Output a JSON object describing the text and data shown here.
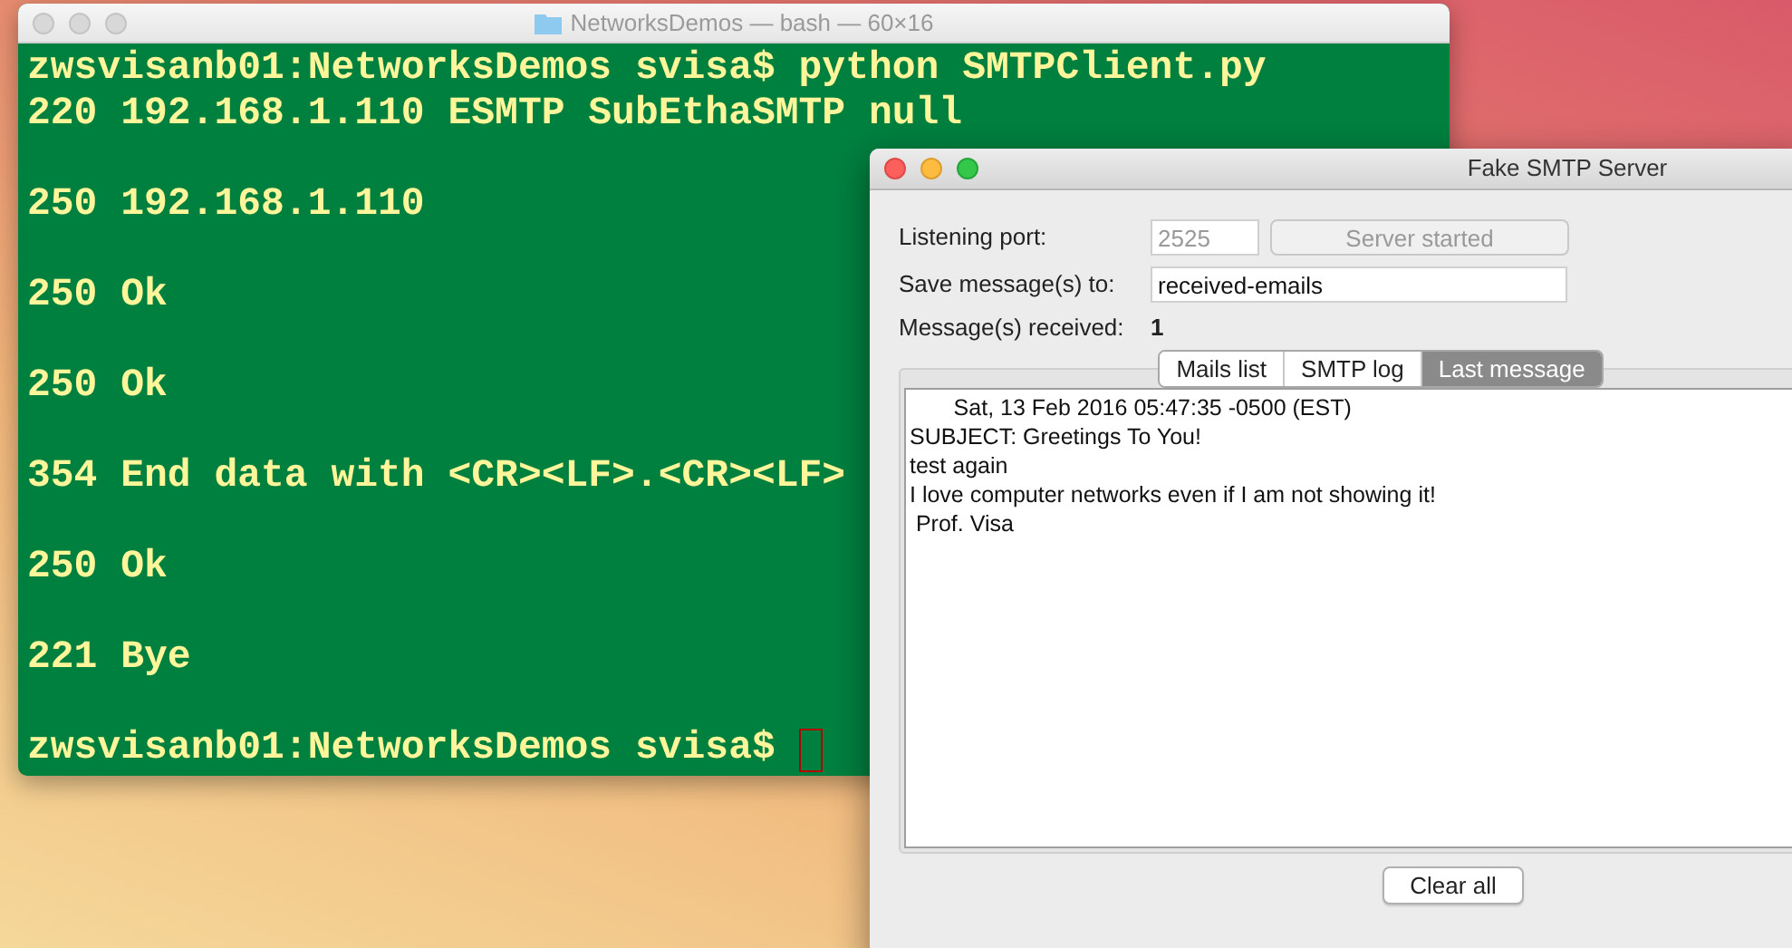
{
  "terminal": {
    "title": "NetworksDemos — bash — 60×16",
    "cursor": true,
    "blocks": [
      [
        "zwsvisanb01:NetworksDemos svisa$ python SMTPClient.py",
        "220 192.168.1.110 ESMTP SubEthaSMTP null"
      ],
      [
        "250 192.168.1.110"
      ],
      [
        "250 Ok"
      ],
      [
        "250 Ok"
      ],
      [
        "354 End data with <CR><LF>.<CR><LF>"
      ],
      [
        "250 Ok"
      ],
      [
        "221 Bye"
      ],
      [
        "zwsvisanb01:NetworksDemos svisa$"
      ]
    ]
  },
  "smtp_window": {
    "title": "Fake SMTP Server",
    "port_label": "Listening port:",
    "port_value": "2525",
    "server_button": {
      "label": "Server started",
      "disabled": true
    },
    "save_label": "Save message(s) to:",
    "save_value": "received-emails",
    "received_label": "Message(s) received:",
    "received_count": "1",
    "tabs": [
      {
        "label": "Mails list",
        "selected": false
      },
      {
        "label": "SMTP log",
        "selected": false
      },
      {
        "label": "Last message",
        "selected": true
      }
    ],
    "message_lines": [
      "       Sat, 13 Feb 2016 05:47:35 -0500 (EST)",
      "SUBJECT: Greetings To You!",
      "test again",
      "I love computer networks even if I am not showing it!",
      " Prof. Visa"
    ],
    "clear_button": "Clear all"
  }
}
